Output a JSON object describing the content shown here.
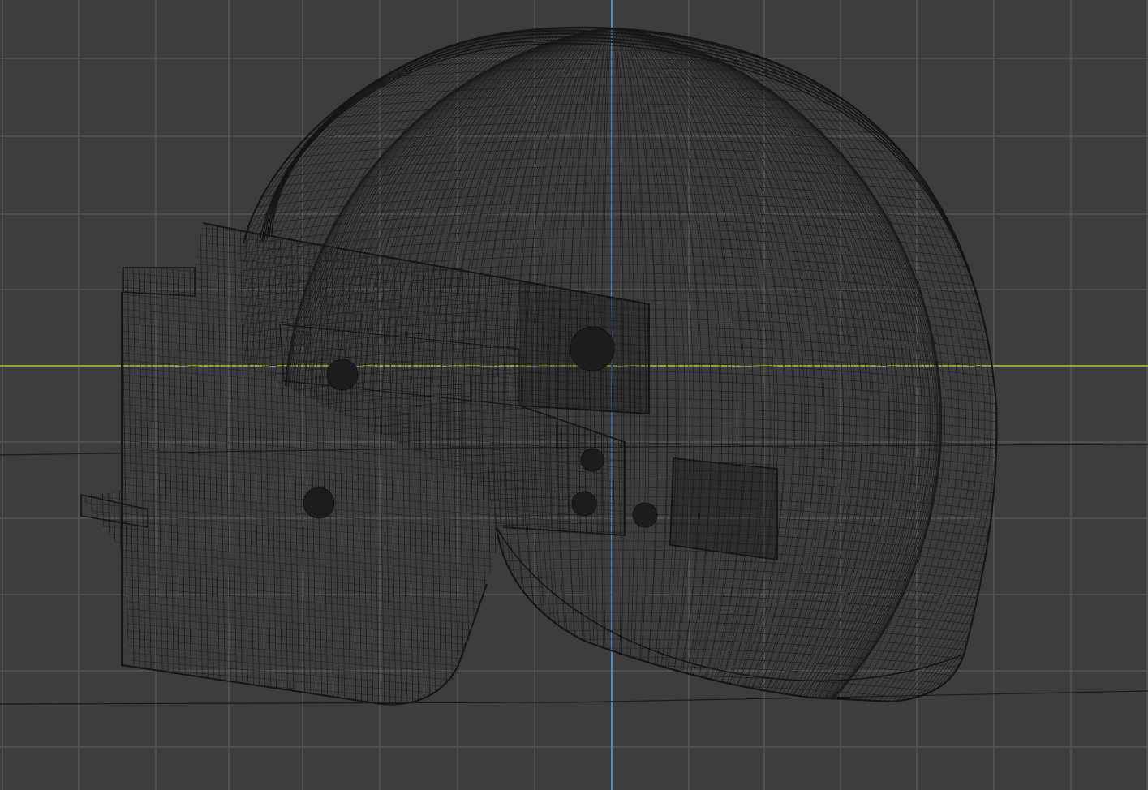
{
  "viewport": {
    "view": "side",
    "shading": "wireframe",
    "object": "helmet",
    "colors": {
      "background": "#3d3d3d",
      "grid": "#565656",
      "x_axis": "#8aa83a",
      "z_axis": "#4a8ac9",
      "wire": "#1b1b1b",
      "wire_dense": "#151515"
    }
  }
}
